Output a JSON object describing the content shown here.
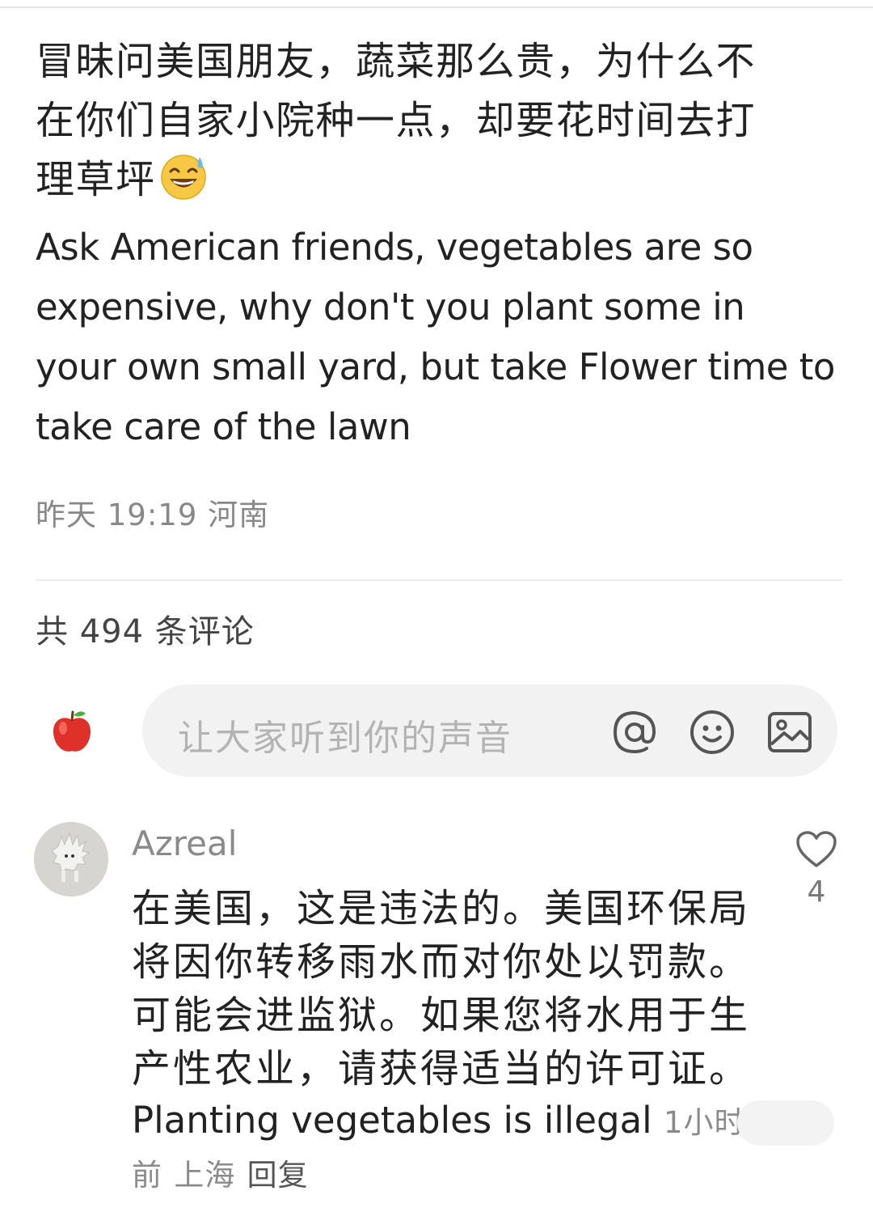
{
  "post": {
    "text_zh_line1": "冒昧问美国朋友，蔬菜那么贵，为什么不",
    "text_zh_line2": "在你们自家小院种一点，却要花时间去打",
    "text_zh_line3": "理草坪",
    "emoji": "sweat-smile-emoji",
    "text_en": "Ask American friends, vegetables are so expensive, why don't you plant some in your own small yard, but take Flower time to take care of the lawn",
    "time": "昨天 19:19",
    "location": "河南"
  },
  "comments_header": {
    "count_label": "共 494 条评论"
  },
  "input": {
    "placeholder": "让大家听到你的声音",
    "avatar_icon": "apple-icon",
    "mention_icon": "at-icon",
    "emoji_icon": "smiley-icon",
    "image_icon": "image-icon"
  },
  "comment": {
    "author": "Azreal",
    "text_zh": "在美国，这是违法的。美国环保局将因你转移雨水而对你处以罚款。可能会进监狱。如果您将水用于生产性农业，请获得适当的许可证。",
    "text_en": "Planting vegetables is illegal",
    "time": "1小时前",
    "location": "上海",
    "reply_label": "回复",
    "like_count": "4",
    "like_icon": "heart-outline-icon"
  },
  "colors": {
    "text_primary": "#222222",
    "text_secondary": "#888888",
    "input_bg": "#f2f2f2",
    "placeholder": "#b3b3b3",
    "apple_red": "#e0302a"
  }
}
